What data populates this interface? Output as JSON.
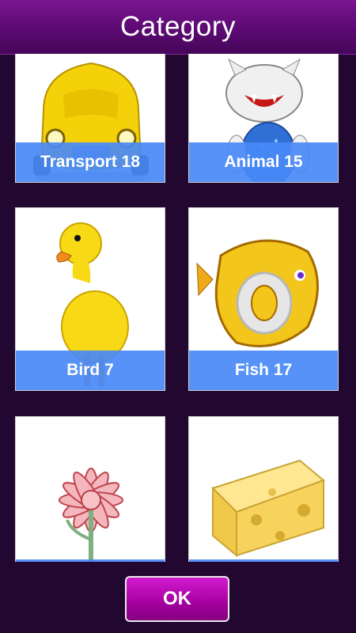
{
  "header": {
    "title": "Category"
  },
  "categories": [
    {
      "label": "Transport 18",
      "icon": "car-icon"
    },
    {
      "label": "Animal 15",
      "icon": "cat-icon"
    },
    {
      "label": "Bird 7",
      "icon": "duck-icon"
    },
    {
      "label": "Fish 17",
      "icon": "fish-icon"
    },
    {
      "label": "",
      "icon": "flower-icon"
    },
    {
      "label": "",
      "icon": "cheese-icon"
    }
  ],
  "footer": {
    "ok_label": "OK"
  },
  "colors": {
    "background": "#220830",
    "header": "#6a0f82",
    "label_band": "#4889f6",
    "ok_button": "#b00aad"
  }
}
